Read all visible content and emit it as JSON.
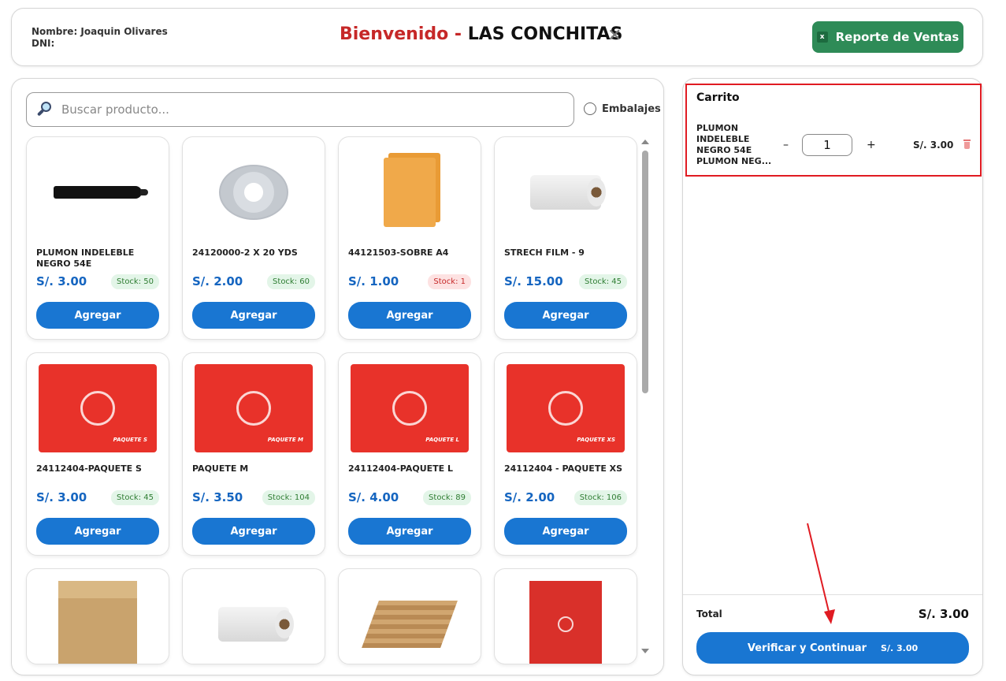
{
  "header": {
    "user_name_label": "Nombre: Joaquin Olivares",
    "dni_label": "DNI:",
    "welcome": "Bienvenido -",
    "store": "LAS CONCHITAS",
    "close_glyph": "✕",
    "report_button": "Reporte de Ventas",
    "report_icon": "excel-icon",
    "report_icon_glyph": "x"
  },
  "search": {
    "placeholder": "Buscar producto...",
    "value": "",
    "filter_label": "Embalajes"
  },
  "products": [
    {
      "name": "PLUMON INDELEBLE NEGRO 54E",
      "price": "S/. 3.00",
      "stock": "Stock: 50",
      "stock_low": false,
      "button": "Agregar",
      "image": "marker"
    },
    {
      "name": "24120000-2 X 20 YDS",
      "price": "S/. 2.00",
      "stock": "Stock: 60",
      "stock_low": false,
      "button": "Agregar",
      "image": "tape"
    },
    {
      "name": "44121503-SOBRE A4",
      "price": "S/. 1.00",
      "stock": "Stock: 1",
      "stock_low": true,
      "button": "Agregar",
      "image": "envelope"
    },
    {
      "name": "STRECH FILM - 9",
      "price": "S/. 15.00",
      "stock": "Stock: 45",
      "stock_low": false,
      "button": "Agregar",
      "image": "film"
    },
    {
      "name": "24112404-PAQUETE S",
      "price": "S/. 3.00",
      "stock": "Stock: 45",
      "stock_low": false,
      "button": "Agregar",
      "image": "redbox",
      "box_label": "PAQUETE S"
    },
    {
      "name": "PAQUETE M",
      "price": "S/. 3.50",
      "stock": "Stock: 104",
      "stock_low": false,
      "button": "Agregar",
      "image": "redbox",
      "box_label": "PAQUETE M"
    },
    {
      "name": "24112404-PAQUETE L",
      "price": "S/. 4.00",
      "stock": "Stock: 89",
      "stock_low": false,
      "button": "Agregar",
      "image": "redbox",
      "box_label": "PAQUETE L"
    },
    {
      "name": "24112404 - PAQUETE XS",
      "price": "S/. 2.00",
      "stock": "Stock: 106",
      "stock_low": false,
      "button": "Agregar",
      "image": "redbox",
      "box_label": "PAQUETE XS"
    }
  ],
  "partial_products": [
    {
      "image": "kraftbox"
    },
    {
      "image": "film"
    },
    {
      "image": "kraftsheets"
    },
    {
      "image": "smallred"
    }
  ],
  "cart": {
    "title": "Carrito",
    "items": [
      {
        "name": "PLUMON INDELEBLE NEGRO 54E PLUMON NEG...",
        "quantity": "1",
        "minus": "–",
        "plus": "+",
        "price": "S/. 3.00"
      }
    ],
    "total_label": "Total",
    "total_value": "S/. 3.00",
    "verify_label": "Verificar y Continuar",
    "verify_amount": "S/. 3.00"
  },
  "colors": {
    "accent": "#1976d2",
    "report_green": "#2e8b57",
    "welcome_red": "#c62828",
    "highlight_red": "#e01b22"
  }
}
